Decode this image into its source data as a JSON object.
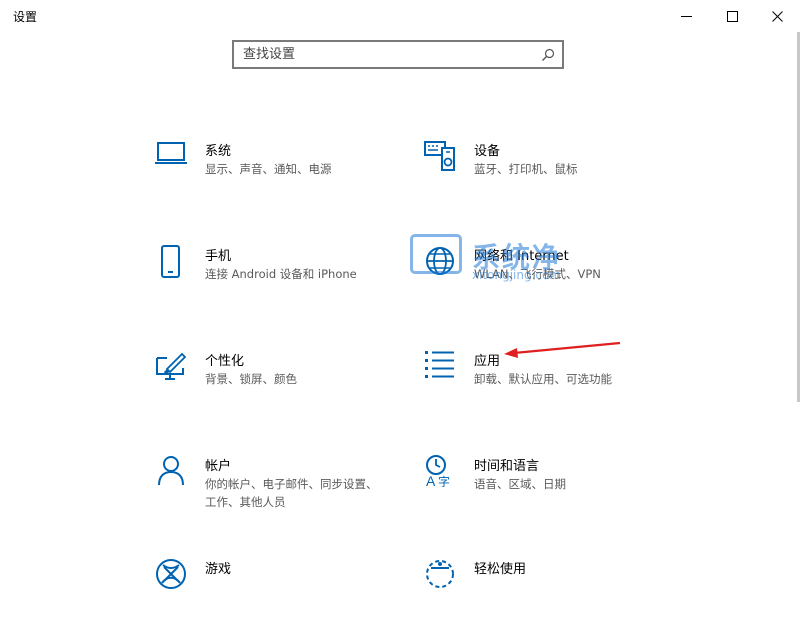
{
  "window": {
    "title": "设置",
    "minimize_glyph": "─",
    "maximize_glyph": "☐",
    "close_glyph": "✕"
  },
  "search": {
    "placeholder": "查找设置",
    "value": ""
  },
  "colors": {
    "accent": "#0063b1",
    "arrow": "#e02020",
    "desc_text": "#5a5a5a"
  },
  "tiles": [
    {
      "icon": "laptop-icon",
      "name": "系统",
      "desc": "显示、声音、通知、电源"
    },
    {
      "icon": "devices-icon",
      "name": "设备",
      "desc": "蓝牙、打印机、鼠标"
    },
    {
      "icon": "phone-icon",
      "name": "手机",
      "desc": "连接 Android 设备和 iPhone"
    },
    {
      "icon": "globe-icon",
      "name": "网络和 Internet",
      "desc": "WLAN、飞行模式、VPN"
    },
    {
      "icon": "personalization-icon",
      "name": "个性化",
      "desc": "背景、锁屏、颜色"
    },
    {
      "icon": "apps-list-icon",
      "name": "应用",
      "desc": "卸载、默认应用、可选功能"
    },
    {
      "icon": "person-icon",
      "name": "帐户",
      "desc": "你的帐户、电子邮件、同步设置、工作、其他人员"
    },
    {
      "icon": "time-language-icon",
      "name": "时间和语言",
      "desc": "语音、区域、日期"
    },
    {
      "icon": "xbox-icon",
      "name": "游戏",
      "desc": ""
    },
    {
      "icon": "ease-of-access-icon",
      "name": "轻松使用",
      "desc": ""
    }
  ],
  "watermark": {
    "text": "系统净",
    "url": "xitongjing.com"
  }
}
